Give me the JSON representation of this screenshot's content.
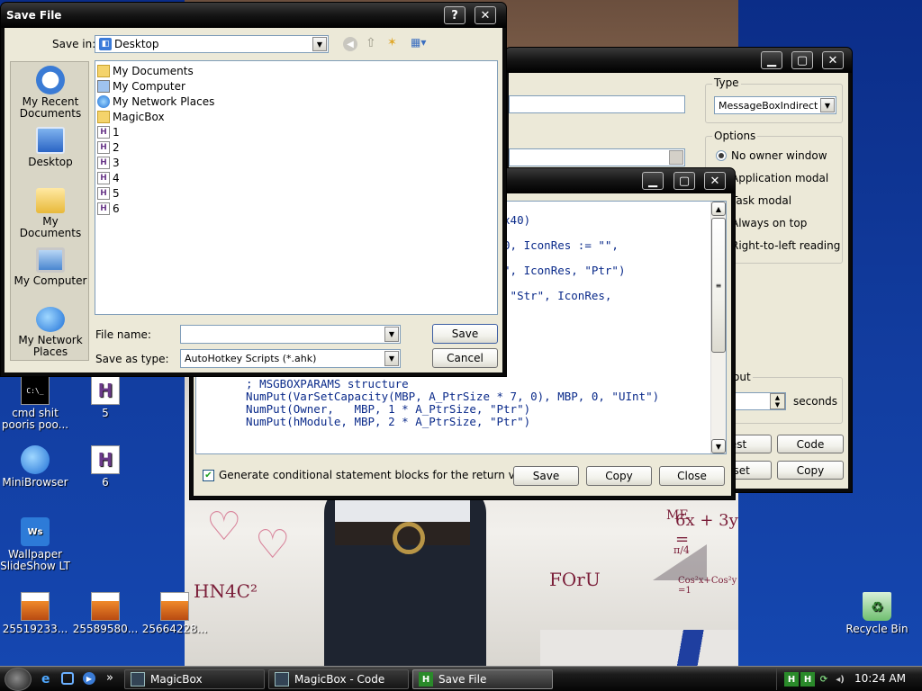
{
  "desktop": {
    "icons": [
      {
        "label": "cmd shit pooris poo...",
        "icon": "cmd-icon"
      },
      {
        "label": "5",
        "icon": "ahk-script-icon"
      },
      {
        "label": "MiniBrowser",
        "icon": "browser-icon"
      },
      {
        "label": "6",
        "icon": "ahk-script-icon"
      },
      {
        "label": "Wallpaper SlideShow LT",
        "icon": "wallpaper-icon"
      },
      {
        "label": "25519233...",
        "icon": "image-file-icon"
      },
      {
        "label": "25589580...",
        "icon": "image-file-icon"
      },
      {
        "label": "25664228...",
        "icon": "image-file-icon"
      },
      {
        "label": "Recycle Bin",
        "icon": "recycle-bin-icon"
      }
    ],
    "wallpaper_text": {
      "me": "ME",
      "equation": "6x + 3y =",
      "formula": "HN4C²",
      "foru": "FOrU",
      "trig": "Cos²x+Cos²y =1",
      "fraction": "π/4"
    }
  },
  "magicbox_window": {
    "type_group": {
      "title": "Type",
      "selected": "MessageBoxIndirect"
    },
    "options_group": {
      "title": "Options",
      "items": [
        "No owner window",
        "Application modal",
        "Task modal",
        "Always on top",
        "Right-to-left reading"
      ],
      "selected_index": 0
    },
    "timeout_group": {
      "title": "out",
      "seconds_label": "seconds"
    },
    "buttons": {
      "test": "est",
      "code": "Code",
      "reset": "eset",
      "copy": "Copy"
    }
  },
  "code_window": {
    "code_lines": [
      "                                        x40)",
      "",
      "                                 ons := 0, IconRes := \"\",",
      "",
      "                                e\", \"Str\", IconRes, \"Ptr\")",
      "",
      "                                raryEx\", \"Str\", IconRes,",
      "",
      "",
      "",
      "",
      "  }",
      "",
      "  ; MSGBOXPARAMS structure",
      "  NumPut(VarSetCapacity(MBP, A_PtrSize * 7, 0), MBP, 0, \"UInt\")",
      "  NumPut(Owner,   MBP, 1 * A_PtrSize, \"Ptr\")",
      "  NumPut(hModule, MBP, 2 * A_PtrSize, \"Ptr\")"
    ],
    "checkbox_label": "Generate conditional statement blocks for the return value",
    "checkbox_checked": true,
    "buttons": {
      "save": "Save",
      "copy": "Copy",
      "close": "Close"
    }
  },
  "save_dialog": {
    "title": "Save File",
    "help": "?",
    "close": "✕",
    "save_in_label": "Save in:",
    "save_in_value": "Desktop",
    "places": [
      {
        "label": "My Recent Documents",
        "icon": "recent-documents-icon"
      },
      {
        "label": "Desktop",
        "icon": "desktop-icon"
      },
      {
        "label": "My Documents",
        "icon": "my-documents-icon"
      },
      {
        "label": "My Computer",
        "icon": "my-computer-icon"
      },
      {
        "label": "My Network Places",
        "icon": "network-places-icon"
      }
    ],
    "files": [
      {
        "name": "My Documents",
        "icon": "folder-docs-icon"
      },
      {
        "name": "My Computer",
        "icon": "computer-icon"
      },
      {
        "name": "My Network Places",
        "icon": "network-icon"
      },
      {
        "name": "MagicBox",
        "icon": "folder-icon"
      },
      {
        "name": "1",
        "icon": "ahk-file-icon"
      },
      {
        "name": "2",
        "icon": "ahk-file-icon"
      },
      {
        "name": "3",
        "icon": "ahk-file-icon"
      },
      {
        "name": "4",
        "icon": "ahk-file-icon"
      },
      {
        "name": "5",
        "icon": "ahk-file-icon"
      },
      {
        "name": "6",
        "icon": "ahk-file-icon"
      }
    ],
    "file_name_label": "File name:",
    "file_name_value": "",
    "save_as_type_label": "Save as type:",
    "save_as_type_value": "AutoHotkey Scripts (*.ahk)",
    "save_button": "Save",
    "cancel_button": "Cancel"
  },
  "taskbar": {
    "tasks": [
      {
        "label": "MagicBox",
        "active": false
      },
      {
        "label": "MagicBox - Code",
        "active": false
      },
      {
        "label": "Save File",
        "active": true
      }
    ],
    "overflow": "»",
    "time": "10:24 AM"
  },
  "colors": {
    "window_face": "#ece9d8",
    "title_bar": "#000000",
    "code_text": "#0a2a8a",
    "desktop_blue": "#123da0"
  }
}
